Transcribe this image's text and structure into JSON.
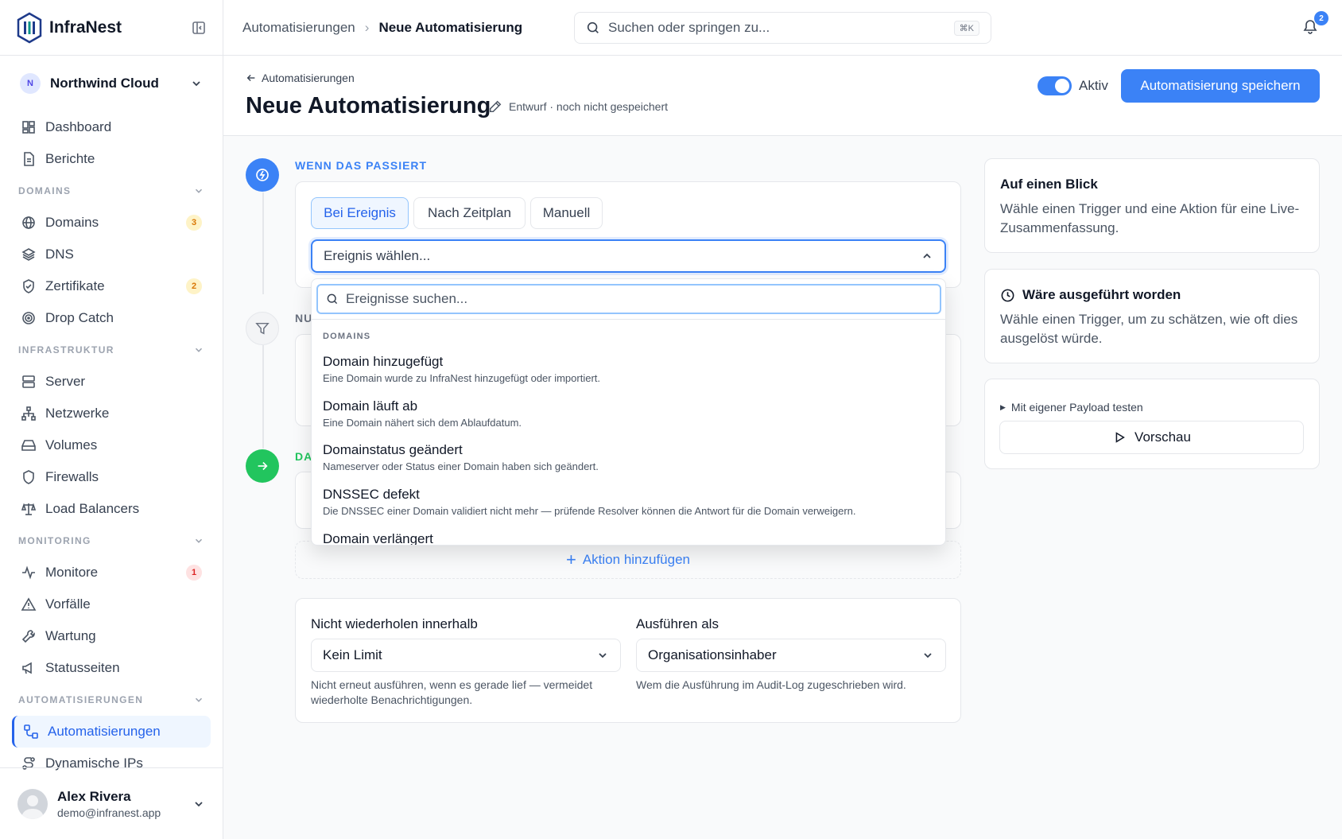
{
  "brand": {
    "name": "InfraNest"
  },
  "org": {
    "initial": "N",
    "name": "Northwind Cloud"
  },
  "nav": {
    "top": [
      {
        "label": "Dashboard",
        "icon": "dashboard-icon"
      },
      {
        "label": "Berichte",
        "icon": "file-text-icon"
      }
    ],
    "sections": [
      {
        "title": "DOMAINS",
        "items": [
          {
            "label": "Domains",
            "icon": "globe-icon",
            "count": "3",
            "count_color": "amber"
          },
          {
            "label": "DNS",
            "icon": "layers-icon"
          },
          {
            "label": "Zertifikate",
            "icon": "shield-check-icon",
            "count": "2",
            "count_color": "amber"
          },
          {
            "label": "Drop Catch",
            "icon": "target-icon"
          }
        ]
      },
      {
        "title": "INFRASTRUKTUR",
        "items": [
          {
            "label": "Server",
            "icon": "server-icon"
          },
          {
            "label": "Netzwerke",
            "icon": "network-icon"
          },
          {
            "label": "Volumes",
            "icon": "hard-drive-icon"
          },
          {
            "label": "Firewalls",
            "icon": "shield-icon"
          },
          {
            "label": "Load Balancers",
            "icon": "scale-icon"
          }
        ]
      },
      {
        "title": "MONITORING",
        "items": [
          {
            "label": "Monitore",
            "icon": "activity-icon",
            "count": "1",
            "count_color": "red"
          },
          {
            "label": "Vorfälle",
            "icon": "alert-triangle-icon"
          },
          {
            "label": "Wartung",
            "icon": "wrench-icon"
          },
          {
            "label": "Statusseiten",
            "icon": "megaphone-icon"
          }
        ]
      },
      {
        "title": "AUTOMATISIERUNGEN",
        "items": [
          {
            "label": "Automatisierungen",
            "icon": "workflow-icon",
            "active": true
          },
          {
            "label": "Dynamische IPs",
            "icon": "route-icon"
          }
        ]
      }
    ]
  },
  "user": {
    "name": "Alex Rivera",
    "email": "demo@infranest.app"
  },
  "topbar": {
    "crumb_parent": "Automatisierungen",
    "crumb_current": "Neue Automatisierung",
    "search_placeholder": "Suchen oder springen zu...",
    "search_shortcut": "⌘K",
    "notifications": "2"
  },
  "header": {
    "back_label": "Automatisierungen",
    "title": "Neue Automatisierung",
    "meta": "Entwurf · noch nicht gespeichert",
    "active_label": "Aktiv",
    "save_label": "Automatisierung speichern"
  },
  "trigger": {
    "step_label": "WENN DAS PASSIERT",
    "tabs": [
      "Bei Ereignis",
      "Nach Zeitplan",
      "Manuell"
    ],
    "select_placeholder": "Ereignis wählen...",
    "search_placeholder": "Ereignisse suchen...",
    "group": "DOMAINS",
    "options": [
      {
        "title": "Domain hinzugefügt",
        "desc": "Eine Domain wurde zu InfraNest hinzugefügt oder importiert."
      },
      {
        "title": "Domain läuft ab",
        "desc": "Eine Domain nähert sich dem Ablaufdatum."
      },
      {
        "title": "Domainstatus geändert",
        "desc": "Nameserver oder Status einer Domain haben sich geändert."
      },
      {
        "title": "DNSSEC defekt",
        "desc": "Die DNSSEC einer Domain validiert nicht mehr — prüfende Resolver können die Antwort für die Domain verweigern."
      },
      {
        "title": "Domain verlängert",
        "desc": ""
      }
    ]
  },
  "filter": {
    "step_label": "NU"
  },
  "action": {
    "step_label": "DA",
    "add_label": "Aktion hinzufügen"
  },
  "settings": {
    "no_repeat_label": "Nicht wiederholen innerhalb",
    "no_repeat_value": "Kein Limit",
    "no_repeat_help": "Nicht erneut ausführen, wenn es gerade lief — vermeidet wiederholte Benachrichtigungen.",
    "run_as_label": "Ausführen als",
    "run_as_value": "Organisationsinhaber",
    "run_as_help": "Wem die Ausführung im Audit-Log zugeschrieben wird."
  },
  "panel": {
    "glance_title": "Auf einen Blick",
    "glance_body": "Wähle einen Trigger und eine Aktion für eine Live-Zusammenfassung.",
    "would_title": "Wäre ausgeführt worden",
    "would_body": "Wähle einen Trigger, um zu schätzen, wie oft dies ausgelöst würde.",
    "payload_label": "Mit eigener Payload testen",
    "preview_label": "Vorschau"
  },
  "colors": {
    "accent": "#3b82f6",
    "success": "#22c55e",
    "warning": "#d97706",
    "danger": "#dc2626"
  }
}
